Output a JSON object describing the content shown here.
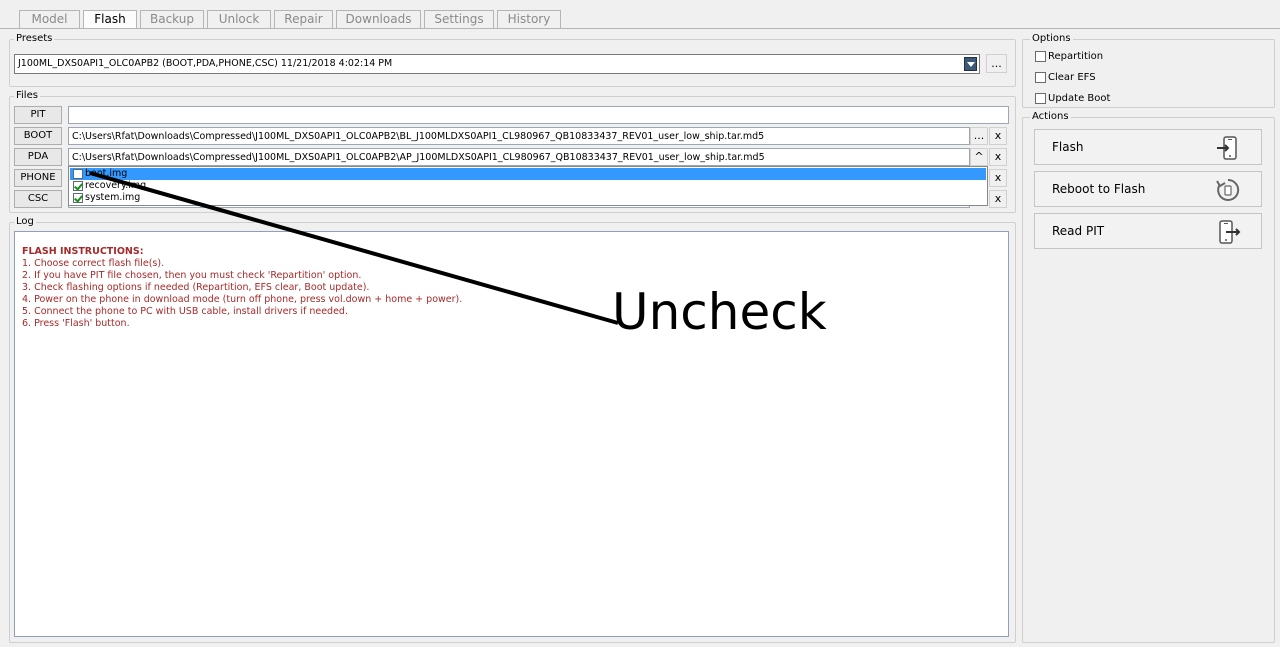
{
  "tabs": [
    {
      "label": "Model"
    },
    {
      "label": "Flash",
      "active": true
    },
    {
      "label": "Backup"
    },
    {
      "label": "Unlock"
    },
    {
      "label": "Repair"
    },
    {
      "label": "Downloads"
    },
    {
      "label": "Settings"
    },
    {
      "label": "History"
    }
  ],
  "presets": {
    "title": "Presets",
    "selected": "J100ML_DXS0API1_OLC0APB2 (BOOT,PDA,PHONE,CSC) 11/21/2018 4:02:14 PM",
    "browse_label": "..."
  },
  "files": {
    "title": "Files",
    "pit": {
      "label": "PIT",
      "value": ""
    },
    "boot": {
      "label": "BOOT",
      "value": "C:\\Users\\Rfat\\Downloads\\Compressed\\J100ML_DXS0API1_OLC0APB2\\BL_J100MLDXS0API1_CL980967_QB10833437_REV01_user_low_ship.tar.md5",
      "browse": "...",
      "clear": "x"
    },
    "pda": {
      "label": "PDA",
      "value": "C:\\Users\\Rfat\\Downloads\\Compressed\\J100ML_DXS0API1_OLC0APB2\\AP_J100MLDXS0API1_CL980967_QB10833437_REV01_user_low_ship.tar.md5",
      "collapse": "^",
      "clear": "x"
    },
    "phone": {
      "label": "PHONE",
      "clear": "x"
    },
    "csc": {
      "label": "CSC",
      "clear": "x"
    },
    "pda_contents": [
      {
        "name": "boot.img",
        "checked": false,
        "selected": true
      },
      {
        "name": "recovery.img",
        "checked": true,
        "selected": false
      },
      {
        "name": "system.img",
        "checked": true,
        "selected": false
      }
    ]
  },
  "log": {
    "title": "Log",
    "heading": "FLASH INSTRUCTIONS:",
    "lines": [
      "1. Choose correct flash file(s).",
      "2. If you have PIT file chosen, then you must check 'Repartition' option.",
      "3. Check flashing options if needed (Repartition, EFS clear, Boot update).",
      "4. Power on the phone in download mode (turn off phone, press vol.down + home + power).",
      "5. Connect the phone to PC with USB cable, install drivers if needed.",
      "6. Press 'Flash' button."
    ]
  },
  "options": {
    "title": "Options",
    "items": [
      {
        "label": "Repartition",
        "checked": false
      },
      {
        "label": "Clear EFS",
        "checked": false
      },
      {
        "label": "Update Boot",
        "checked": false
      }
    ]
  },
  "actions": {
    "title": "Actions",
    "buttons": [
      {
        "label": "Flash",
        "icon": "phone-arrow-in-icon"
      },
      {
        "label": "Reboot to Flash",
        "icon": "reboot-icon"
      },
      {
        "label": "Read PIT",
        "icon": "phone-arrow-out-icon"
      }
    ]
  },
  "annotation": {
    "text": "Uncheck"
  }
}
